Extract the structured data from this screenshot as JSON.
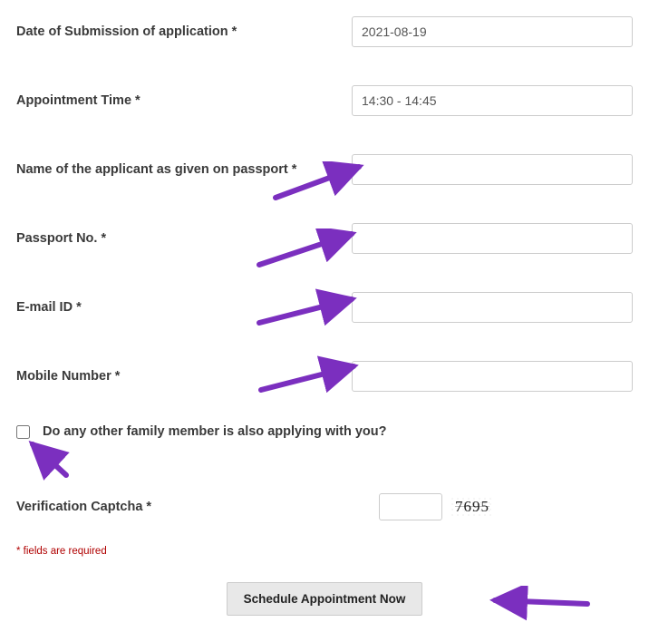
{
  "fields": {
    "submission_date": {
      "label": "Date of Submission of application *",
      "value": "2021-08-19"
    },
    "appointment_time": {
      "label": "Appointment Time *",
      "value": "14:30 - 14:45"
    },
    "applicant_name": {
      "label": "Name of the applicant as given on passport *",
      "value": ""
    },
    "passport_no": {
      "label": "Passport No. *",
      "value": ""
    },
    "email": {
      "label": "E-mail ID *",
      "value": ""
    },
    "mobile": {
      "label": "Mobile Number *",
      "value": ""
    }
  },
  "family_checkbox": {
    "label": "Do any other family member is also applying with you?",
    "checked": false
  },
  "captcha": {
    "label": "Verification Captcha *",
    "code": "7695"
  },
  "required_note": "* fields are required",
  "submit_label": "Schedule Appointment Now",
  "annotation_color": "#7b2fbf"
}
